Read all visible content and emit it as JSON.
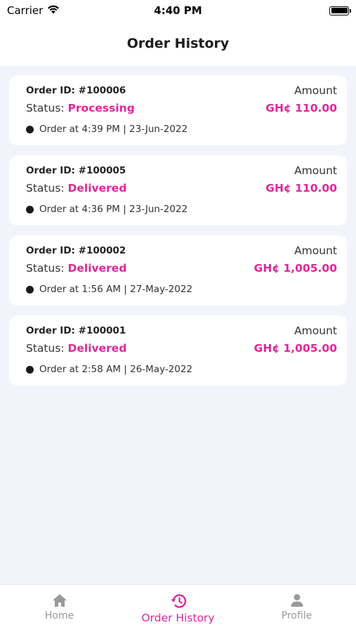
{
  "status_bar": {
    "carrier": "Carrier",
    "time": "4:40 PM"
  },
  "header": {
    "title": "Order History"
  },
  "orders": [
    {
      "id_label": "Order ID: #100006",
      "amount_label": "Amount",
      "status_prefix": "Status: ",
      "status": "Processing",
      "amount": "GH¢ 110.00",
      "ordered_at": "Order at 4:39 PM | 23-Jun-2022"
    },
    {
      "id_label": "Order ID: #100005",
      "amount_label": "Amount",
      "status_prefix": "Status: ",
      "status": "Delivered",
      "amount": "GH¢ 110.00",
      "ordered_at": "Order at 4:36 PM | 23-Jun-2022"
    },
    {
      "id_label": "Order ID: #100002",
      "amount_label": "Amount",
      "status_prefix": "Status: ",
      "status": "Delivered",
      "amount": "GH¢ 1,005.00",
      "ordered_at": "Order at 1:56 AM | 27-May-2022"
    },
    {
      "id_label": "Order ID: #100001",
      "amount_label": "Amount",
      "status_prefix": "Status: ",
      "status": "Delivered",
      "amount": "GH¢ 1,005.00",
      "ordered_at": "Order at 2:58 AM | 26-May-2022"
    }
  ],
  "tabs": [
    {
      "label": "Home",
      "icon": "home-icon",
      "active": false
    },
    {
      "label": "Order History",
      "icon": "history-icon",
      "active": true
    },
    {
      "label": "Profile",
      "icon": "person-icon",
      "active": false
    }
  ],
  "colors": {
    "accent": "#e0269c",
    "background": "#f2f4fb",
    "card": "#ffffff",
    "inactive_tab": "#9a9a9a"
  }
}
